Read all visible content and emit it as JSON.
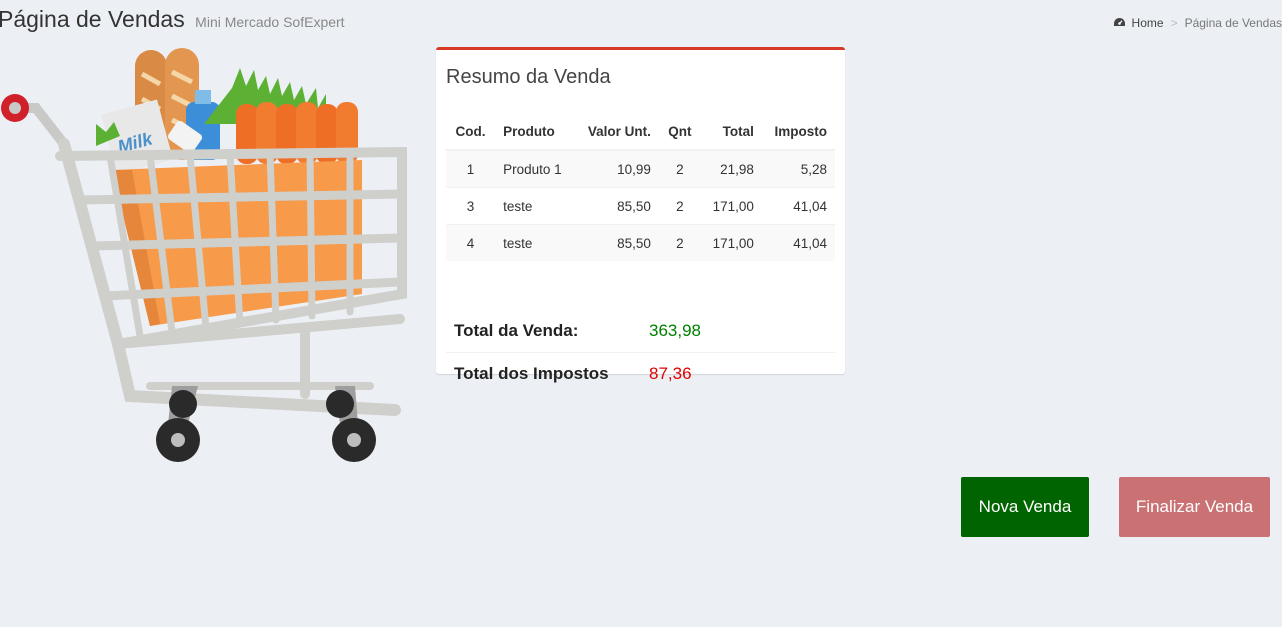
{
  "header": {
    "title": "Página de Vendas",
    "subtitle": "Mini Mercado SofExpert"
  },
  "breadcrumb": {
    "home_icon": "dashboard-icon",
    "home": "Home",
    "current": "Página de Vendas"
  },
  "summary": {
    "title": "Resumo da Venda",
    "columns": [
      "Cod.",
      "Produto",
      "Valor Unt.",
      "Qnt",
      "Total",
      "Imposto"
    ],
    "rows": [
      [
        "1",
        "Produto 1",
        "10,99",
        "2",
        "21,98",
        "5,28"
      ],
      [
        "3",
        "teste",
        "85,50",
        "2",
        "171,00",
        "41,04"
      ],
      [
        "4",
        "teste",
        "85,50",
        "2",
        "171,00",
        "41,04"
      ]
    ],
    "total_label": "Total da Venda:",
    "total_value": "363,98",
    "tax_label": "Total dos Impostos",
    "tax_value": "87,36"
  },
  "buttons": {
    "new_sale": "Nova Venda",
    "finish_sale": "Finalizar Venda"
  },
  "colors": {
    "box_accent": "#d73925",
    "new_sale_bg": "#006400",
    "finish_sale_bg": "#c97173",
    "positive": "#008000",
    "negative": "#e00000"
  }
}
